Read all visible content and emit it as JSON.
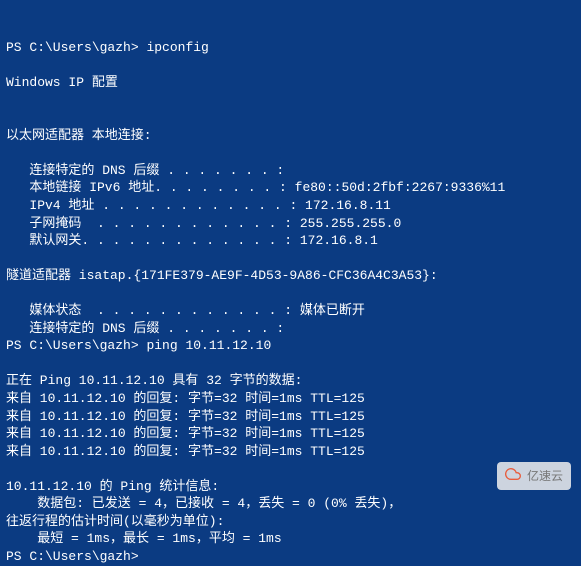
{
  "prompt1": "PS C:\\Users\\gazh>",
  "cmd1": "ipconfig",
  "ipconfig_header": "Windows IP 配置",
  "adapter_header": "以太网适配器 本地连接:",
  "dns_suffix_label": "   连接特定的 DNS 后缀 . . . . . . . :",
  "link_local_label": "   本地链接 IPv6 地址. . . . . . . . : ",
  "link_local_value": "fe80::50d:2fbf:2267:9336%11",
  "ipv4_label": "   IPv4 地址 . . . . . . . . . . . . : ",
  "ipv4_value": "172.16.8.11",
  "subnet_label": "   子网掩码  . . . . . . . . . . . . : ",
  "subnet_value": "255.255.255.0",
  "gateway_label": "   默认网关. . . . . . . . . . . . . : ",
  "gateway_value": "172.16.8.1",
  "tunnel_header": "隧道适配器 isatap.{171FE379-AE9F-4D53-9A86-CFC36A4C3A53}:",
  "media_label": "   媒体状态  . . . . . . . . . . . . : ",
  "media_value": "媒体已断开",
  "tunnel_dns_label": "   连接特定的 DNS 后缀 . . . . . . . :",
  "prompt2": "PS C:\\Users\\gazh>",
  "cmd2": "ping 10.11.12.10",
  "ping_header": "正在 Ping 10.11.12.10 具有 32 字节的数据:",
  "ping_reply1": "来自 10.11.12.10 的回复: 字节=32 时间=1ms TTL=125",
  "ping_reply2": "来自 10.11.12.10 的回复: 字节=32 时间=1ms TTL=125",
  "ping_reply3": "来自 10.11.12.10 的回复: 字节=32 时间=1ms TTL=125",
  "ping_reply4": "来自 10.11.12.10 的回复: 字节=32 时间=1ms TTL=125",
  "stats_header": "10.11.12.10 的 Ping 统计信息:",
  "stats_packets": "    数据包: 已发送 = 4，已接收 = 4，丢失 = 0 (0% 丢失)，",
  "roundtrip_header": "往返行程的估计时间(以毫秒为单位):",
  "roundtrip_values": "    最短 = 1ms，最长 = 1ms，平均 = 1ms",
  "prompt3": "PS C:\\Users\\gazh>",
  "watermark_text": "亿速云"
}
